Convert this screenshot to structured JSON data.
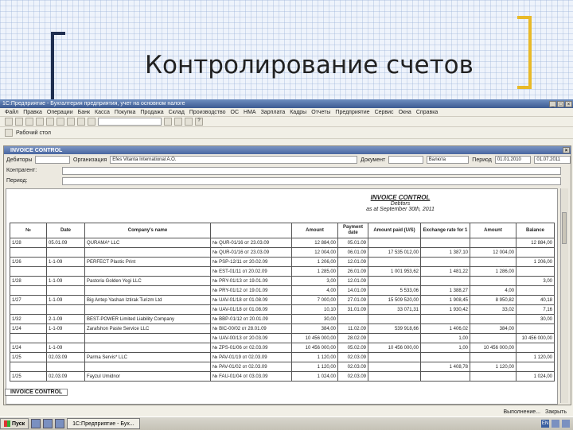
{
  "slide": {
    "title": "Контролирование счетов"
  },
  "app": {
    "window_title": "1С:Предприятие - Бухгалтерия предприятия, учет на основном налоге",
    "menu": [
      "Файл",
      "Правка",
      "Операции",
      "Банк",
      "Касса",
      "Покупка",
      "Продажа",
      "Склад",
      "Производство",
      "ОС",
      "НМА",
      "Зарплата",
      "Кадры",
      "Отчеты",
      "Предприятие",
      "Сервис",
      "Окна",
      "Справка"
    ],
    "toolbar2_tag": "Рабочий стол",
    "document": {
      "title": "INVOICE CONTROL",
      "filters": {
        "org_label": "Дебиторы",
        "org_value": "",
        "org2_label": "Организация",
        "org2_value": "Efes Vitanta International A.O.",
        "document_label": "Документ",
        "document_value": "",
        "currency_value": "Валюта",
        "period_label": "Период",
        "period_from": "01.01.2010",
        "period_to": "01.07.2011"
      },
      "fields": [
        {
          "label": "Контрагент:",
          "value": ""
        },
        {
          "label": "Период:",
          "value": ""
        }
      ],
      "report": {
        "title": "INVOICE CONTROL",
        "subtitle": "Debtors",
        "date_line": "as at September 30th, 2011",
        "columns": [
          "№",
          "Date",
          "Company's name",
          "",
          "Amount",
          "Payment date",
          "Amount paid (U/S)",
          "Exchange rate for 1",
          "Amount",
          "Balance"
        ],
        "rows": [
          [
            "1/28",
            "05.01.09",
            "QURAMA* LLC",
            "№ QUR-01/16 от 23.03.09",
            "12 884,00",
            "05.01.09",
            "",
            "",
            "",
            "12 884,00"
          ],
          [
            "",
            "",
            "",
            "№ QUR-01/16 от 23.03.09",
            "12 004,00",
            "06.01.09",
            "17 535 012,00",
            "1 387,10",
            "12 004,00",
            ""
          ],
          [
            "1/26",
            "1-1-09",
            "PERFECT Plastic Print",
            "№ PSP-12/11 от 20.02.09",
            "1 206,00",
            "12.01.09",
            "",
            "",
            "",
            "1 206,00"
          ],
          [
            "",
            "",
            "",
            "№ EST-01/11 от 20.02.09",
            "1 285,00",
            "26.01.09",
            "1 001 953,62",
            "1 481,22",
            "1 286,00",
            ""
          ],
          [
            "1/28",
            "1-1-09",
            "Pastoria Golden Yogi LLC",
            "№ PRY-01/13 от 19.01.09",
            "3,00",
            "12.01.09",
            "",
            "",
            "",
            "3,00"
          ],
          [
            "",
            "",
            "",
            "№ PRY-01/12 от 19.01.09",
            "4,00",
            "14.01.09",
            "5 533,06",
            "1 388,27",
            "4,00",
            ""
          ],
          [
            "1/27",
            "1-1-09",
            "Big Antep Yashan Iztirak Turizm Ltd",
            "№ UAV-01/18 от 01.08.09",
            "7 000,00",
            "27.01.09",
            "15 509 520,00",
            "1 908,45",
            "8 950,82",
            "40,18"
          ],
          [
            "",
            "",
            "",
            "№ UAV-01/18 от 01.08.09",
            "10,10",
            "31.01.09",
            "33 071,31",
            "1 930,42",
            "33,02",
            "7,16"
          ],
          [
            "1/32",
            "2-1-09",
            "BEST-POWER Limited Liability Company",
            "№ BBP-01/12 от 20.01.09",
            "30,00",
            "",
            "",
            "",
            "",
            "30,00"
          ],
          [
            "1/24",
            "1-1-09",
            "Zarafshon Paste Service LLC",
            "№ BIC-00/02 от 28.01.09",
            "384,00",
            "11.02.09",
            "539 918,66",
            "1 406,02",
            "384,00",
            ""
          ],
          [
            "",
            "",
            "",
            "№ UAV-00/13 от 20.03.09",
            "10 456 000,00",
            "28.02.09",
            "",
            "1,00",
            "",
            "10 456 000,00"
          ],
          [
            "1/24",
            "1-1-09",
            "",
            "№ ZPS-01/06 от 02.03.09",
            "10 456 000,00",
            "05.02.09",
            "10 456 000,00",
            "1,00",
            "10 456 000,00",
            ""
          ],
          [
            "1/25",
            "02.03.09",
            "Parma Servis* LLC",
            "№ PAV-01/19 от 02.03.09",
            "1 120,00",
            "02.03.09",
            "",
            "",
            "",
            "1 120,00"
          ],
          [
            "",
            "",
            "",
            "№ PAV-01/02 от 02.03.09",
            "1 120,00",
            "02.03.09",
            "",
            "1 408,78",
            "1 120,00",
            ""
          ],
          [
            "1/25",
            "02.03.09",
            "Fayzul Umidnor",
            "№ FAU-01/04 от 03.03.09",
            "1 024,00",
            "02.03.09",
            "",
            "",
            "",
            "1 024,00"
          ]
        ]
      }
    },
    "window_tab": "INVOICE CONTROL",
    "status": [
      "Выполнение...",
      "Закрыть"
    ]
  },
  "taskbar": {
    "start_label": "Пуск",
    "active_window": "1С:Предприятие - Бух...",
    "lang": "EN"
  }
}
